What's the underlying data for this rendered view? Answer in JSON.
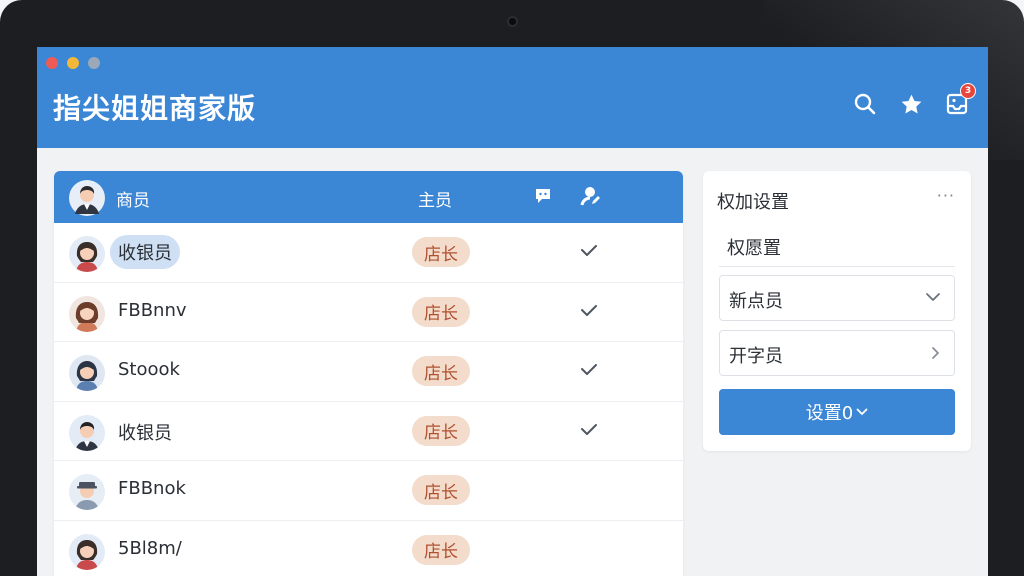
{
  "app": {
    "title": "指尖姐姐商家版",
    "notification_count": "3"
  },
  "table": {
    "headers": {
      "name": "商员",
      "role": "主员"
    },
    "rows": [
      {
        "name": "收银员",
        "role": "店长",
        "checked": true,
        "highlighted": true,
        "avatar": "female"
      },
      {
        "name": "FBBnnv",
        "role": "店长",
        "checked": true,
        "highlighted": false,
        "avatar": "female-brown"
      },
      {
        "name": "Stoook",
        "role": "店长",
        "checked": true,
        "highlighted": false,
        "avatar": "female-dark"
      },
      {
        "name": "收银员",
        "role": "店长",
        "checked": true,
        "highlighted": false,
        "avatar": "male-suit"
      },
      {
        "name": "FBBnok",
        "role": "店长",
        "checked": false,
        "highlighted": false,
        "avatar": "male-hat"
      },
      {
        "name": "5Bl8m/",
        "role": "店长",
        "checked": false,
        "highlighted": false,
        "avatar": "female"
      }
    ]
  },
  "settings": {
    "title": "权加设置",
    "more": "···",
    "subtitle": "权愿置",
    "dropdown_value": "新点员",
    "link_item": "开字员",
    "button_label": "设置0"
  },
  "colors": {
    "primary": "#3c86d6",
    "role_pill_bg": "#f3dccb",
    "role_pill_text": "#b0502f",
    "highlight_pill": "#cfe0f5"
  },
  "icons": {
    "header": [
      "search-icon",
      "star-icon",
      "inbox-icon"
    ],
    "table_header": [
      "avatar-icon",
      "chat-icon",
      "user-edit-icon"
    ],
    "rows": [
      "avatar-icon",
      "check-icon"
    ],
    "settings": [
      "more-icon",
      "chevron-down-icon",
      "chevron-right-icon"
    ]
  }
}
